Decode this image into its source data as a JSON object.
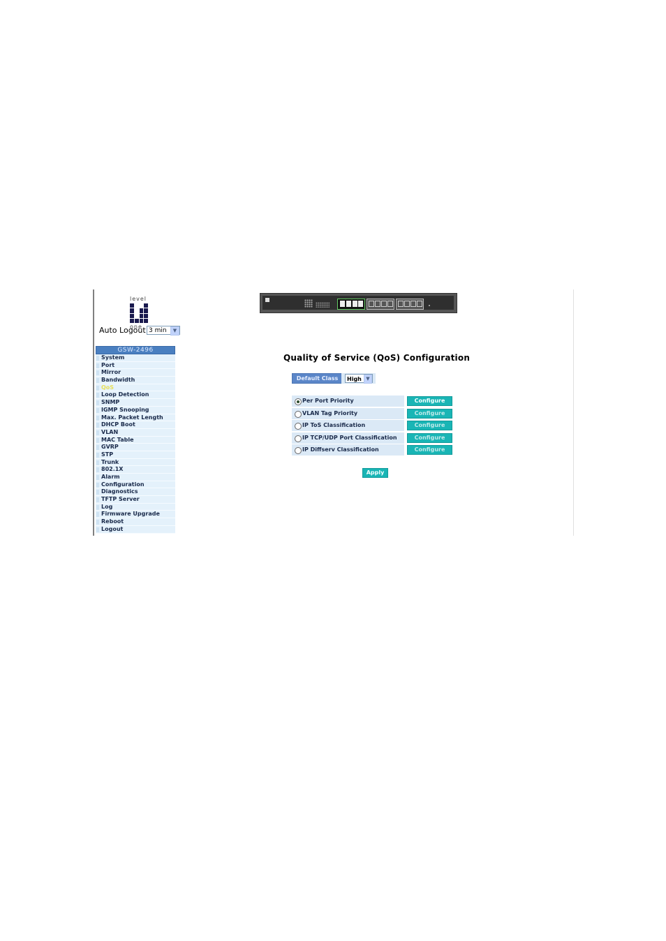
{
  "logo": {
    "top_text": "level",
    "bottom_text": "one"
  },
  "auto_logout": {
    "label": "Auto Logout",
    "value": "3 min"
  },
  "menu": {
    "header": "GSW-2496",
    "items": [
      "System",
      "Port",
      "Mirror",
      "Bandwidth",
      "QoS",
      "Loop Detection",
      "SNMP",
      "IGMP Snooping",
      "Max. Packet Length",
      "DHCP Boot",
      "VLAN",
      "MAC Table",
      "GVRP",
      "STP",
      "Trunk",
      "802.1X",
      "Alarm",
      "Configuration",
      "Diagnostics",
      "TFTP Server",
      "Log",
      "Firmware Upgrade",
      "Reboot",
      "Logout"
    ],
    "active": "QoS"
  },
  "main": {
    "title": "Quality of Service (QoS) Configuration",
    "default_class_label": "Default Class",
    "default_class_value": "High",
    "options": [
      {
        "label": "Per Port Priority",
        "selected": true,
        "button": "Configure"
      },
      {
        "label": "VLAN Tag Priority",
        "selected": false,
        "button": "Configure"
      },
      {
        "label": "IP ToS Classification",
        "selected": false,
        "button": "Configure"
      },
      {
        "label": "IP TCP/UDP Port Classification",
        "selected": false,
        "button": "Configure"
      },
      {
        "label": "IP Diffserv Classification",
        "selected": false,
        "button": "Configure"
      }
    ],
    "apply_label": "Apply"
  },
  "colors": {
    "menu_header": "#4a7fc0",
    "menu_item": "#e4f1fb",
    "active_item": "#e8e05a",
    "button": "#19b5b5",
    "row_bg": "#dbe9f6"
  }
}
